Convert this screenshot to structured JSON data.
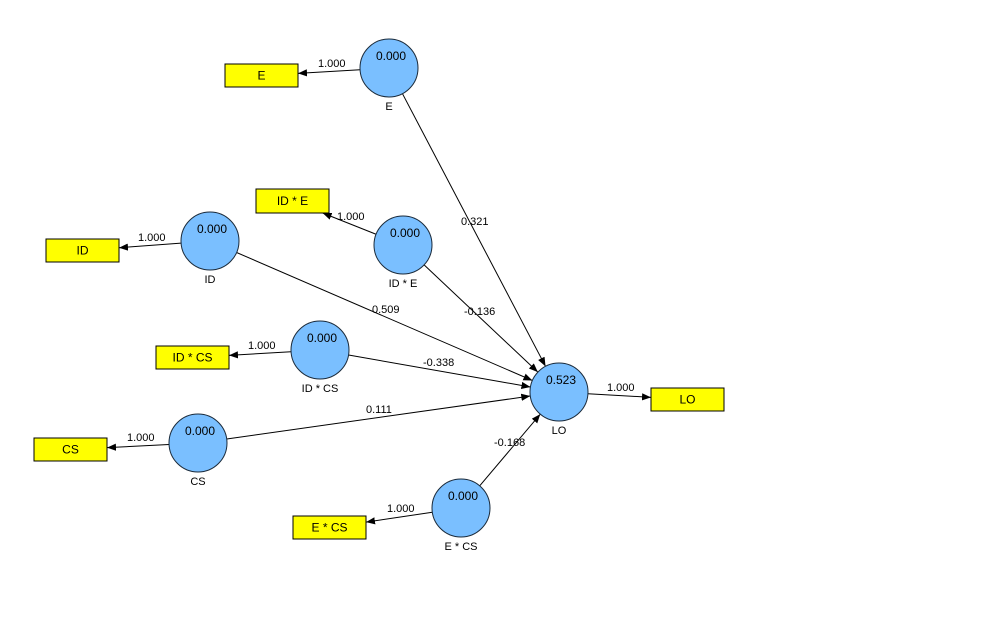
{
  "diagram": {
    "type": "pls-sem-path-model",
    "colors": {
      "construct_fill": "#7ABFFF",
      "indicator_fill": "#FFFF00",
      "line": "#000000"
    },
    "constructs": [
      {
        "id": "E",
        "label": "E",
        "value": "0.000"
      },
      {
        "id": "IDxE",
        "label": "ID * E",
        "value": "0.000"
      },
      {
        "id": "ID",
        "label": "ID",
        "value": "0.000"
      },
      {
        "id": "IDxCS",
        "label": "ID * CS",
        "value": "0.000"
      },
      {
        "id": "CS",
        "label": "CS",
        "value": "0.000"
      },
      {
        "id": "ExCS",
        "label": "E * CS",
        "value": "0.000"
      },
      {
        "id": "LO",
        "label": "LO",
        "value": "0.523"
      }
    ],
    "indicators": [
      {
        "id": "ind_E",
        "label": "E"
      },
      {
        "id": "ind_IDxE",
        "label": "ID * E"
      },
      {
        "id": "ind_ID",
        "label": "ID"
      },
      {
        "id": "ind_IDxCS",
        "label": "ID * CS"
      },
      {
        "id": "ind_CS",
        "label": "CS"
      },
      {
        "id": "ind_ExCS",
        "label": "E * CS"
      },
      {
        "id": "ind_LO",
        "label": "LO"
      }
    ],
    "loadings": [
      {
        "from": "E",
        "to": "ind_E",
        "value": "1.000"
      },
      {
        "from": "IDxE",
        "to": "ind_IDxE",
        "value": "1.000"
      },
      {
        "from": "ID",
        "to": "ind_ID",
        "value": "1.000"
      },
      {
        "from": "IDxCS",
        "to": "ind_IDxCS",
        "value": "1.000"
      },
      {
        "from": "CS",
        "to": "ind_CS",
        "value": "1.000"
      },
      {
        "from": "ExCS",
        "to": "ind_ExCS",
        "value": "1.000"
      },
      {
        "from": "LO",
        "to": "ind_LO",
        "value": "1.000"
      }
    ],
    "paths": [
      {
        "from": "E",
        "to": "LO",
        "value": "0.321"
      },
      {
        "from": "IDxE",
        "to": "LO",
        "value": "-0.136"
      },
      {
        "from": "ID",
        "to": "LO",
        "value": "0.509"
      },
      {
        "from": "IDxCS",
        "to": "LO",
        "value": "-0.338"
      },
      {
        "from": "CS",
        "to": "LO",
        "value": "0.111"
      },
      {
        "from": "ExCS",
        "to": "LO",
        "value": "-0.168"
      }
    ]
  }
}
